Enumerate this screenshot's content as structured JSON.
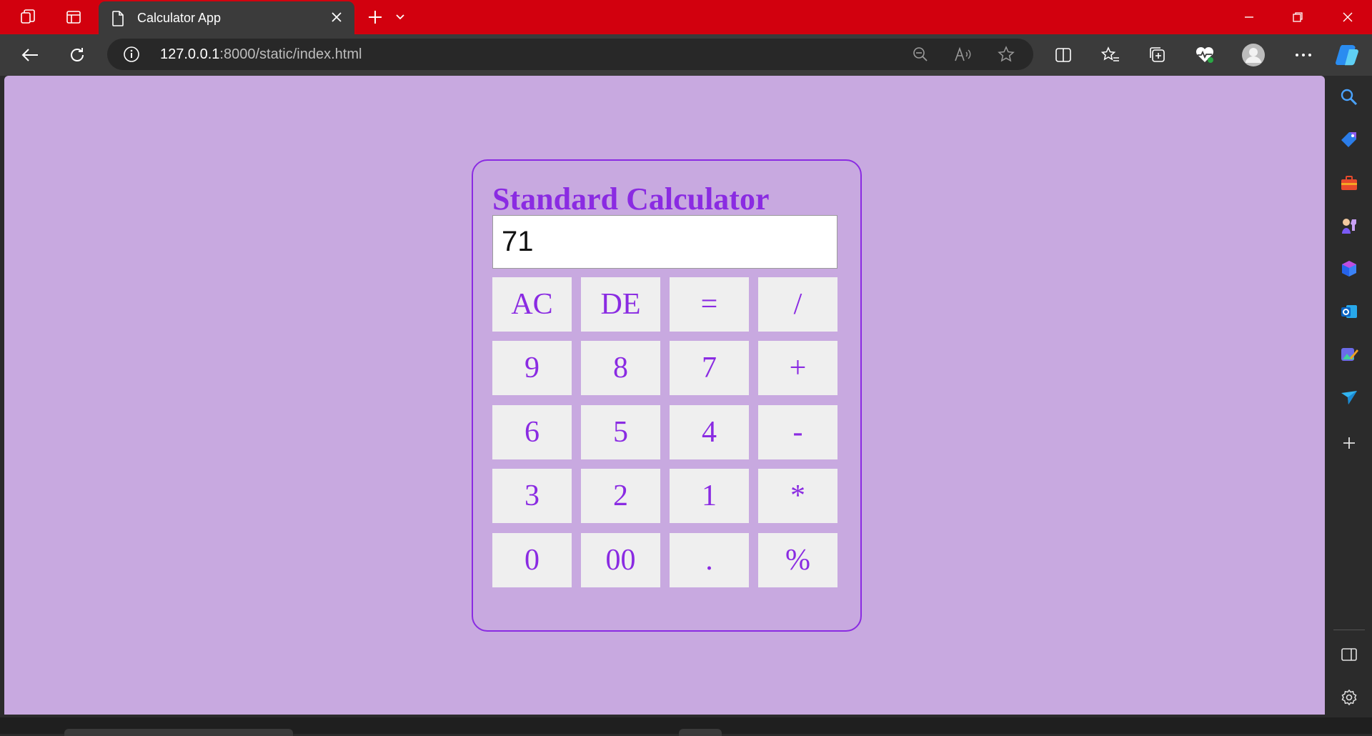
{
  "browser": {
    "tab": {
      "title": "Calculator App"
    },
    "address": {
      "host": "127.0.0.1",
      "path": ":8000/static/index.html"
    }
  },
  "calculator": {
    "title": "Standard Calculator",
    "display_value": "71",
    "keys": [
      [
        "AC",
        "DE",
        "=",
        "/"
      ],
      [
        "9",
        "8",
        "7",
        "+"
      ],
      [
        "6",
        "5",
        "4",
        "-"
      ],
      [
        "3",
        "2",
        "1",
        "*"
      ],
      [
        "0",
        "00",
        ".",
        "%"
      ]
    ]
  },
  "colors": {
    "titlebar": "#d2000e",
    "page_background": "#c8a9e0",
    "accent": "#8a2be2",
    "key_background": "#efefef"
  },
  "icons": {
    "titlebar": [
      "workspaces-icon",
      "tab-actions-icon",
      "file-icon",
      "close-icon",
      "new-tab-icon",
      "tab-list-icon",
      "minimize-icon",
      "restore-icon",
      "window-close-icon"
    ],
    "toolbar": [
      "back-icon",
      "refresh-icon",
      "info-icon",
      "zoom-out-icon",
      "read-aloud-icon",
      "favorite-star-icon",
      "split-screen-icon",
      "favorites-icon",
      "collections-icon",
      "browser-essentials-icon",
      "profile-icon",
      "more-icon",
      "copilot-icon"
    ],
    "sidebar": [
      "search-icon",
      "shopping-tag-icon",
      "tools-icon",
      "games-icon",
      "office-icon",
      "outlook-icon",
      "designer-icon",
      "send-icon",
      "add-icon",
      "sidebar-toggle-icon",
      "settings-icon"
    ]
  }
}
